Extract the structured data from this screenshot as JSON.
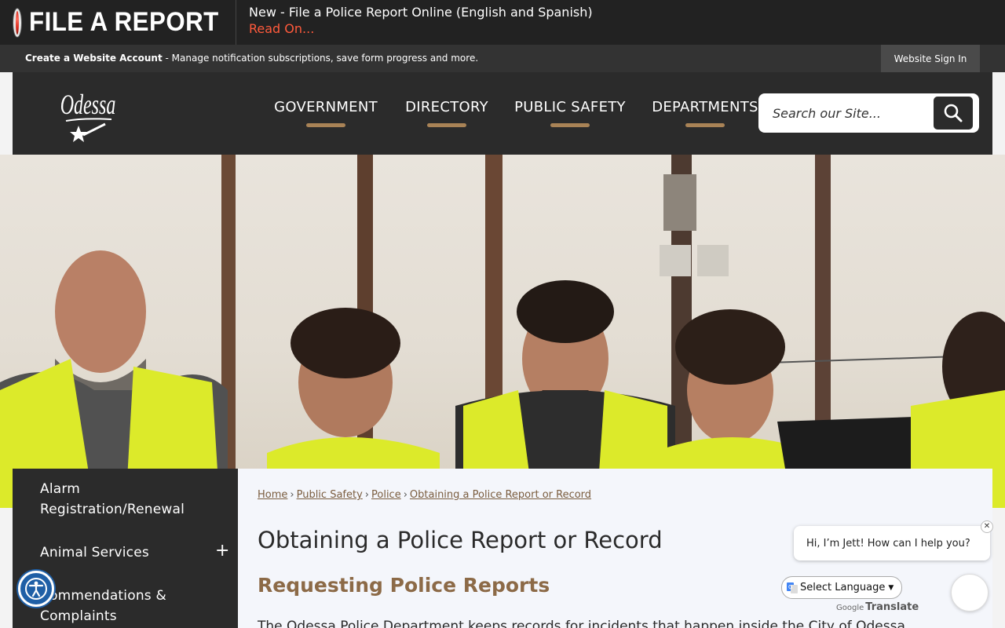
{
  "alert": {
    "title": "FILE A REPORT",
    "message": "New - File a Police Report Online (English and Spanish)",
    "link": "Read On..."
  },
  "account": {
    "create_link": "Create a Website Account",
    "description": " - Manage notification subscriptions, save form progress and more.",
    "signin": "Website Sign In"
  },
  "header": {
    "logo_text": "Odessa",
    "nav": [
      "GOVERNMENT",
      "DIRECTORY",
      "PUBLIC SAFETY",
      "DEPARTMENTS"
    ],
    "search_placeholder": "Search our Site..."
  },
  "sidebar": {
    "items": [
      {
        "label": "Alarm Registration/Renewal",
        "expandable": false
      },
      {
        "label": "Animal Services",
        "expandable": true,
        "toggle": "+"
      },
      {
        "label": "Commendations & Complaints",
        "expandable": false
      }
    ]
  },
  "breadcrumb": [
    "Home",
    "Public Safety",
    "Police",
    "Obtaining a Police Report or Record"
  ],
  "breadcrumb_sep": "›",
  "content": {
    "title": "Obtaining a Police Report or Record",
    "subtitle": "Requesting Police Reports",
    "body": "The Odessa Police Department keeps records for incidents that happen inside the City of Odessa."
  },
  "chat": {
    "greeting": "Hi, I’m Jett! How can I help you?",
    "close": "✕"
  },
  "translate": {
    "select_label": "Select Language",
    "powered_by": "Google",
    "translate_label": "Translate"
  },
  "colors": {
    "accent": "#a98356",
    "alert_link": "#ff5a3c",
    "dark": "#2b2b2b",
    "subtitle": "#8c6a47"
  },
  "icons": {
    "alert": "alert-circle-icon",
    "search": "search-icon",
    "accessibility": "accessibility-icon",
    "translate": "google-translate-icon"
  }
}
